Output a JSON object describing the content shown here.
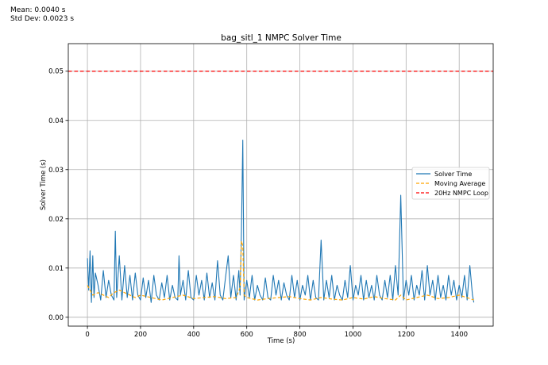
{
  "stats": {
    "mean_label": "Mean: 0.0040 s",
    "std_label": "Std Dev: 0.0023 s"
  },
  "chart_data": {
    "type": "line",
    "title": "bag_sitl_1 NMPC Solver Time",
    "xlabel": "Time (s)",
    "ylabel": "Solver Time (s)",
    "xlim": [
      -72,
      1528
    ],
    "ylim": [
      -0.0018,
      0.0556
    ],
    "xticks": [
      0,
      200,
      400,
      600,
      800,
      1000,
      1200,
      1400
    ],
    "xtick_labels": [
      "0",
      "200",
      "400",
      "600",
      "800",
      "1000",
      "1200",
      "1400"
    ],
    "yticks": [
      0.0,
      0.01,
      0.02,
      0.03,
      0.04,
      0.05
    ],
    "ytick_labels": [
      "0.00",
      "0.01",
      "0.02",
      "0.03",
      "0.04",
      "0.05"
    ],
    "grid": true,
    "legend_position": "center-right",
    "series": [
      {
        "name": "Solver Time",
        "style": "solid",
        "color": "#1f77b4",
        "x": [
          0,
          5,
          10,
          15,
          20,
          25,
          30,
          40,
          50,
          60,
          70,
          80,
          90,
          100,
          105,
          110,
          120,
          130,
          140,
          150,
          160,
          170,
          180,
          190,
          200,
          210,
          220,
          230,
          240,
          250,
          260,
          270,
          280,
          290,
          300,
          310,
          320,
          330,
          340,
          345,
          350,
          360,
          370,
          380,
          390,
          400,
          410,
          420,
          430,
          440,
          450,
          460,
          470,
          480,
          490,
          500,
          510,
          520,
          530,
          540,
          550,
          560,
          570,
          575,
          580,
          585,
          590,
          600,
          610,
          620,
          630,
          640,
          650,
          660,
          670,
          680,
          690,
          700,
          710,
          720,
          730,
          740,
          750,
          760,
          770,
          780,
          790,
          800,
          810,
          820,
          830,
          840,
          850,
          860,
          870,
          880,
          890,
          900,
          910,
          920,
          930,
          940,
          950,
          960,
          970,
          980,
          990,
          1000,
          1010,
          1020,
          1030,
          1040,
          1050,
          1060,
          1070,
          1080,
          1090,
          1100,
          1110,
          1120,
          1130,
          1140,
          1150,
          1160,
          1170,
          1180,
          1190,
          1200,
          1210,
          1220,
          1230,
          1240,
          1250,
          1260,
          1270,
          1280,
          1290,
          1300,
          1310,
          1320,
          1330,
          1340,
          1350,
          1360,
          1370,
          1380,
          1390,
          1400,
          1410,
          1420,
          1430,
          1440,
          1450,
          1455
        ],
        "values": [
          0.012,
          0.0055,
          0.0135,
          0.003,
          0.0125,
          0.004,
          0.009,
          0.0065,
          0.0035,
          0.0095,
          0.004,
          0.0075,
          0.0045,
          0.0035,
          0.0175,
          0.004,
          0.0125,
          0.0035,
          0.0105,
          0.004,
          0.0085,
          0.0035,
          0.009,
          0.0045,
          0.0035,
          0.008,
          0.004,
          0.0075,
          0.003,
          0.0085,
          0.0045,
          0.0035,
          0.007,
          0.004,
          0.0085,
          0.0035,
          0.0065,
          0.004,
          0.0035,
          0.0125,
          0.0045,
          0.0075,
          0.0035,
          0.0095,
          0.004,
          0.0035,
          0.0085,
          0.0045,
          0.0075,
          0.0035,
          0.009,
          0.004,
          0.007,
          0.0035,
          0.0115,
          0.0045,
          0.0035,
          0.008,
          0.0125,
          0.004,
          0.0085,
          0.0035,
          0.0095,
          0.0045,
          0.0175,
          0.036,
          0.0035,
          0.0075,
          0.004,
          0.0085,
          0.0035,
          0.0065,
          0.0045,
          0.0035,
          0.008,
          0.004,
          0.0035,
          0.0085,
          0.0045,
          0.0075,
          0.0035,
          0.007,
          0.0045,
          0.0035,
          0.0085,
          0.004,
          0.0075,
          0.0035,
          0.0065,
          0.0045,
          0.0085,
          0.0035,
          0.0075,
          0.004,
          0.0035,
          0.0157,
          0.0035,
          0.0075,
          0.004,
          0.0085,
          0.0035,
          0.0065,
          0.0045,
          0.0035,
          0.0075,
          0.004,
          0.0105,
          0.0035,
          0.0065,
          0.0045,
          0.0085,
          0.0035,
          0.0075,
          0.004,
          0.0065,
          0.0035,
          0.0085,
          0.0045,
          0.0035,
          0.0075,
          0.004,
          0.0085,
          0.0035,
          0.0105,
          0.0045,
          0.0248,
          0.0035,
          0.0075,
          0.0045,
          0.0085,
          0.0035,
          0.0065,
          0.0045,
          0.0095,
          0.0035,
          0.0105,
          0.0045,
          0.0075,
          0.0035,
          0.0085,
          0.004,
          0.0065,
          0.0035,
          0.0085,
          0.0045,
          0.0075,
          0.0035,
          0.0065,
          0.004,
          0.0085,
          0.0035,
          0.0105,
          0.0045,
          0.003
        ]
      },
      {
        "name": "Moving Average",
        "style": "dashed",
        "color": "#ffa500",
        "x": [
          0,
          10,
          20,
          40,
          60,
          80,
          100,
          120,
          140,
          160,
          180,
          200,
          240,
          280,
          320,
          360,
          400,
          440,
          480,
          520,
          560,
          575,
          580,
          585,
          590,
          600,
          640,
          680,
          720,
          760,
          800,
          840,
          880,
          920,
          960,
          1000,
          1040,
          1080,
          1120,
          1160,
          1180,
          1200,
          1240,
          1280,
          1320,
          1360,
          1400,
          1440,
          1455
        ],
        "values": [
          0.0065,
          0.0055,
          0.0045,
          0.005,
          0.0045,
          0.004,
          0.005,
          0.0055,
          0.005,
          0.0045,
          0.004,
          0.0045,
          0.004,
          0.0035,
          0.004,
          0.0045,
          0.0038,
          0.004,
          0.0042,
          0.0038,
          0.004,
          0.006,
          0.0155,
          0.0145,
          0.0045,
          0.004,
          0.0035,
          0.0038,
          0.004,
          0.0042,
          0.0038,
          0.0035,
          0.004,
          0.0037,
          0.0035,
          0.004,
          0.0037,
          0.0042,
          0.0038,
          0.0035,
          0.0045,
          0.0035,
          0.004,
          0.0045,
          0.0038,
          0.004,
          0.0045,
          0.0038,
          0.0035
        ]
      },
      {
        "name": "20Hz NMPC Loop",
        "style": "dashed",
        "color": "#ff0000",
        "y": 0.05
      }
    ]
  }
}
